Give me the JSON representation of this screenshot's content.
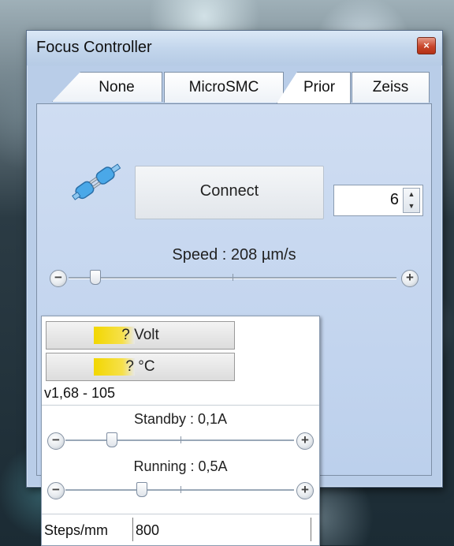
{
  "window": {
    "title": "Focus Controller",
    "close_label": "×"
  },
  "tabs": [
    {
      "label": "None",
      "active": false
    },
    {
      "label": "MicroSMC",
      "active": false
    },
    {
      "label": "Prior",
      "active": true
    },
    {
      "label": "Zeiss",
      "active": false
    }
  ],
  "controls": {
    "connect_label": "Connect",
    "port_value": "6",
    "speed_label": "Speed : 208 µm/s",
    "speed_level": 0.08,
    "minus": "−",
    "plus": "+"
  },
  "dropdown": {
    "icon": "tools-icon",
    "arrow": "▼"
  },
  "popup": {
    "volt_label": "? Volt",
    "temp_label": "? °C",
    "version": "v1,68 - 105",
    "standby_label": "Standby : 0,1A",
    "standby_level": 0.2,
    "running_label": "Running : 0,5A",
    "running_level": 0.33,
    "steps_label": "Steps/mm",
    "steps_value": "800"
  },
  "colors": {
    "panel": "#bcd0ec",
    "dropdown_highlight": "#f8d55a",
    "meter_fill": "#f2d700",
    "close_button": "#c8452b"
  }
}
